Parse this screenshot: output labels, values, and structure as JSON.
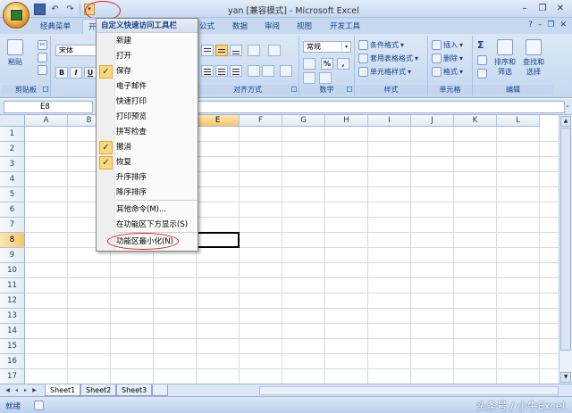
{
  "window": {
    "title": "yan  [兼容模式] - Microsoft Excel",
    "controls": [
      "–",
      "❐",
      "✕"
    ]
  },
  "qat": {
    "save_icon": "save-icon",
    "undo_icon": "undo-icon",
    "redo_icon": "redo-icon"
  },
  "tabs": [
    {
      "label": "经典菜单"
    },
    {
      "label": "开"
    },
    {
      "label": "公式"
    },
    {
      "label": "数据"
    },
    {
      "label": "审阅"
    },
    {
      "label": "视图"
    },
    {
      "label": "开发工具"
    }
  ],
  "ribbon": {
    "clipboard": {
      "paste": "粘贴",
      "label": "剪贴板"
    },
    "font": {
      "name": "宋体",
      "bold": "B",
      "italic": "I",
      "underline": "U"
    },
    "alignment": {
      "label": "对齐方式"
    },
    "number": {
      "format": "常规",
      "percent": "%",
      "comma": ",",
      "label": "数字"
    },
    "styles": {
      "cond": "条件格式",
      "table": "套用表格格式",
      "cell": "单元格样式",
      "label": "样式"
    },
    "cells": {
      "insert": "插入",
      "delete": "删除",
      "format": "格式",
      "label": "单元格"
    },
    "editing": {
      "sort": "排序和",
      "sort2": "筛选",
      "find": "查找和",
      "find2": "选择",
      "label": "编辑",
      "sigma": "Σ"
    }
  },
  "formula": {
    "namebox": "E8",
    "value": ""
  },
  "columns": [
    "A",
    "B",
    "C",
    "D",
    "E",
    "F",
    "G",
    "H",
    "I",
    "J",
    "K",
    "L"
  ],
  "rows": [
    "1",
    "2",
    "3",
    "4",
    "5",
    "6",
    "7",
    "8",
    "9",
    "10",
    "11",
    "12",
    "13",
    "14",
    "15",
    "16",
    "17"
  ],
  "selected": {
    "column": "E",
    "row": "8"
  },
  "sheets": [
    "Sheet1",
    "Sheet2",
    "Sheet3"
  ],
  "status": {
    "mode": "就绪",
    "watermark": "头条号 / 小牛Excel"
  },
  "menu": {
    "title": "自定义快速访问工具栏",
    "items": [
      {
        "label": "新建",
        "checked": false
      },
      {
        "label": "打开",
        "checked": false
      },
      {
        "label": "保存",
        "checked": true
      },
      {
        "label": "电子邮件",
        "checked": false
      },
      {
        "label": "快速打印",
        "checked": false
      },
      {
        "label": "打印预览",
        "checked": false
      },
      {
        "label": "拼写检查",
        "checked": false
      },
      {
        "label": "撤消",
        "checked": true
      },
      {
        "label": "恢复",
        "checked": true
      },
      {
        "label": "升序排序",
        "checked": false
      },
      {
        "label": "降序排序",
        "checked": false
      },
      {
        "label": "其他命令(M)...",
        "checked": false
      },
      {
        "label": "在功能区下方显示(S)",
        "checked": false
      },
      {
        "label": "功能区最小化(N)",
        "checked": false
      }
    ],
    "check_glyph": "✓"
  },
  "colors": {
    "accent": "#15428b",
    "highlight": "#f8c769",
    "annotation": "#e02020"
  }
}
